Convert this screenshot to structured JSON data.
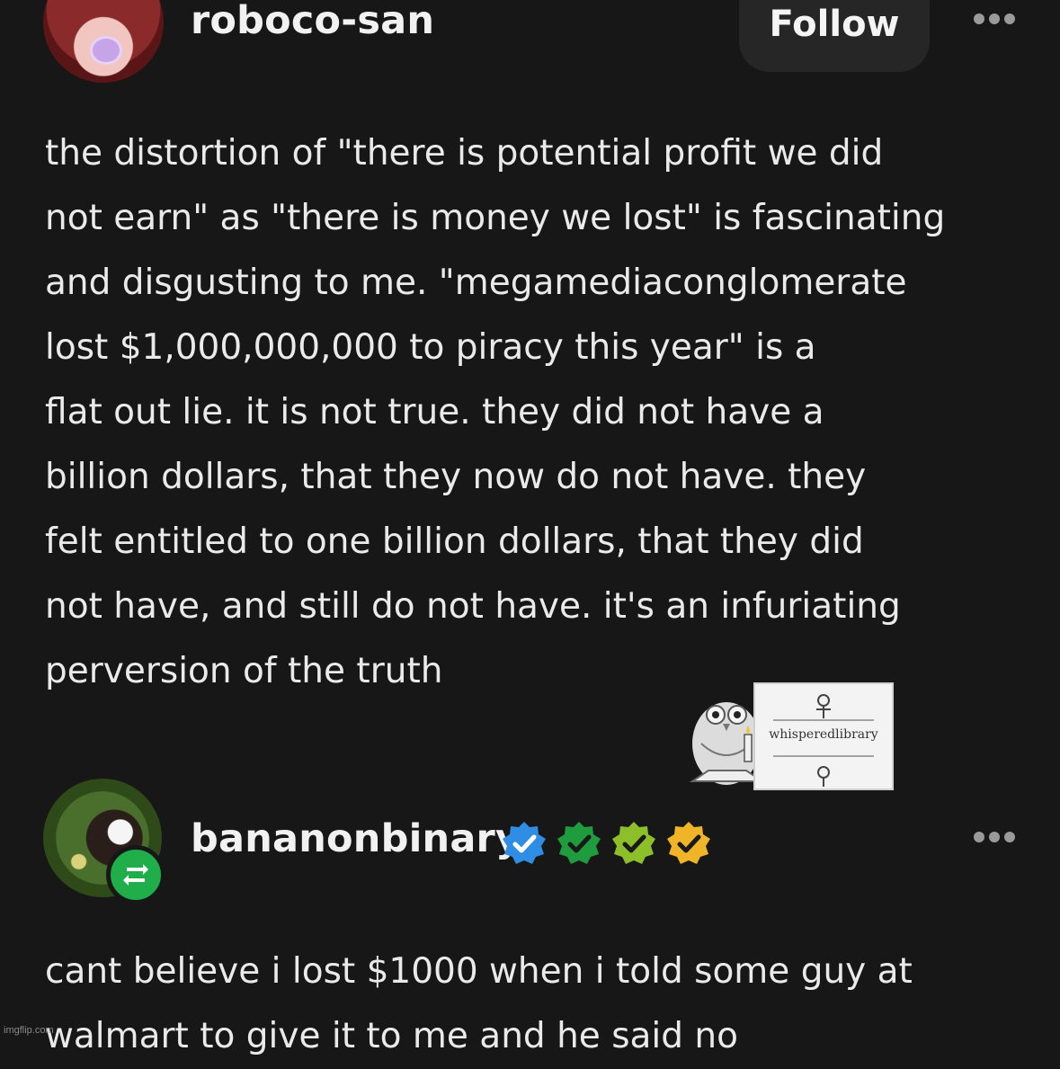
{
  "post1": {
    "username": "roboco-san",
    "follow_label": "Follow",
    "text": "the distortion of \"there is potential profit we did\nnot earn\" as \"there is money we lost\" is fascinating\nand disgusting to me. \"megamediaconglomerate\nlost $1,000,000,000 to piracy this year\" is a\nflat out lie. it is not true. they did not have a\nbillion dollars, that they now do not have. they\nfelt entitled to one billion dollars, that they did\nnot have, and still do not have. it's an infuriating\nperversion of the truth"
  },
  "stamp": {
    "label": "whisperedlibrary"
  },
  "post2": {
    "username": "bananonbinary",
    "badges": [
      {
        "icon": "verified-badge-blue-icon",
        "color": "#2f8de4"
      },
      {
        "icon": "verified-badge-green-icon",
        "color": "#1f9d3e"
      },
      {
        "icon": "verified-badge-lime-icon",
        "color": "#8cbf2a"
      },
      {
        "icon": "verified-badge-yellow-icon",
        "color": "#f0b429"
      }
    ],
    "text": "cant believe i lost $1000 when i told some guy at\nwalmart to give it to me and he said no"
  },
  "watermark": "imgflip.com",
  "colors": {
    "background": "#171717",
    "text": "#eaeaea",
    "follow_bg": "#262626",
    "reblog_green": "#1fae4a"
  }
}
